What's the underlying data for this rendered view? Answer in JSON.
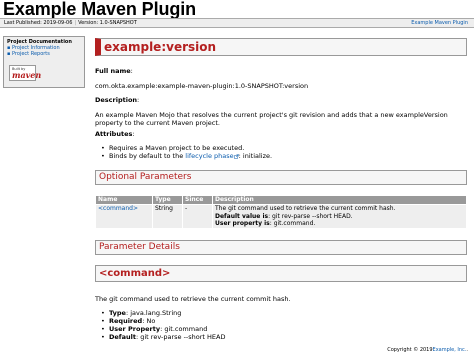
{
  "banner": {
    "title": "Example Maven Plugin"
  },
  "breadcrumbs": {
    "last_published": "Last Published: 2019-09-06",
    "version": "Version: 1.0-SNAPSHOT",
    "right_link": "Example Maven Plugin"
  },
  "sidebar": {
    "title": "Project Documentation",
    "items": [
      {
        "label": "Project Information"
      },
      {
        "label": "Project Reports"
      }
    ],
    "badge": {
      "built_by": "Built by",
      "maven": "maven"
    }
  },
  "main": {
    "heading": "example:version",
    "full_name_label": "Full name",
    "full_name_colon": ":",
    "full_name_value": "com.okta.example:example-maven-plugin:1.0-SNAPSHOT:version",
    "description_label": "Description",
    "description_colon": ":",
    "description_text": "An example Maven Mojo that resolves the current project's git revision and adds that a new exampleVersion property to the current Maven project.",
    "attributes_label": "Attributes",
    "attributes_colon": ":",
    "attributes": [
      {
        "text": "Requires a Maven project to be executed."
      },
      {
        "prefix": "Binds by default to the",
        "link": "lifecycle phase",
        "suffix": ": initialize."
      }
    ],
    "optional_heading": "Optional Parameters",
    "table": {
      "headers": [
        "Name",
        "Type",
        "Since",
        "Description"
      ],
      "rows": [
        {
          "name": "<command>",
          "type": "String",
          "since": "-",
          "desc": "The git command used to retrieve the current commit hash.",
          "default_label": "Default value is",
          "default_value": ": git rev-parse --short HEAD.",
          "property_label": "User property is",
          "property_value": ": git.command."
        }
      ]
    },
    "details_heading": "Parameter Details",
    "command_heading": "<command>",
    "command_desc": "The git command used to retrieve the current commit hash.",
    "command_props": [
      {
        "label": "Type",
        "value": ": java.lang.String"
      },
      {
        "label": "Required",
        "value": ": No"
      },
      {
        "label": "User Property",
        "value": ": git.command"
      },
      {
        "label": "Default",
        "value": ": git rev-parse --short HEAD"
      }
    ]
  },
  "footer": {
    "copyright": "Copyright © 2019",
    "org_link": "Example, Inc.",
    "suffix": "."
  },
  "colors": {
    "accent": "#b42020",
    "link": "#0b5cad",
    "table_header": "#999999"
  }
}
